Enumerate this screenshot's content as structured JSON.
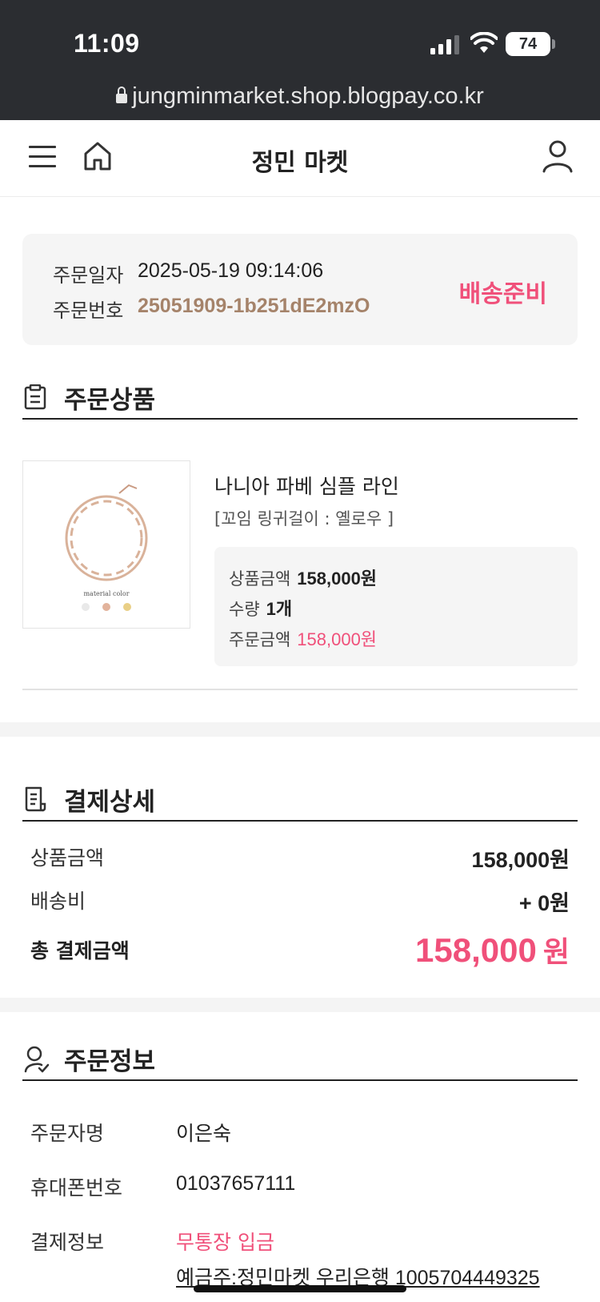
{
  "status_bar": {
    "time": "11:09",
    "battery": "74",
    "url": "jungminmarket.shop.blogpay.co.kr"
  },
  "nav": {
    "title": "정민 마켓"
  },
  "order_summary": {
    "date_label": "주문일자",
    "date_value": "2025-05-19 09:14:06",
    "number_label": "주문번호",
    "number_value": "25051909-1b251dE2mzO",
    "status": "배송준비"
  },
  "order_products": {
    "section_title": "주문상품",
    "product": {
      "image_caption": "material color",
      "name": "나니아 파베 심플 라인",
      "option": "[꼬임 링귀걸이 : 옐로우 ]",
      "price_label": "상품금액",
      "price_value": "158,000원",
      "qty_label": "수량",
      "qty_value": "1개",
      "order_label": "주문금액",
      "order_value": "158,000원"
    }
  },
  "payment_detail": {
    "section_title": "결제상세",
    "product_amount_label": "상품금액",
    "product_amount_value": "158,000원",
    "shipping_label": "배송비",
    "shipping_value": "+ 0원",
    "total_label": "총 결제금액",
    "total_value": "158,000",
    "total_unit": "원"
  },
  "order_info": {
    "section_title": "주문정보",
    "orderer_label": "주문자명",
    "orderer_value": "이은숙",
    "phone_label": "휴대폰번호",
    "phone_value": "01037657111",
    "payment_label": "결제정보",
    "payment_method": "무통장 입금",
    "account_info": "예금주:정민마켓 우리은행 1005704449325"
  },
  "colors": {
    "accent_pink": "#f0507a",
    "order_no_brown": "#a5836a",
    "status_bar_bg": "#2b2d31"
  },
  "icons": [
    "menu-icon",
    "home-icon",
    "user-icon",
    "clipboard-icon",
    "receipt-icon",
    "person-check-icon",
    "lock-icon",
    "signal-icon",
    "wifi-icon"
  ]
}
